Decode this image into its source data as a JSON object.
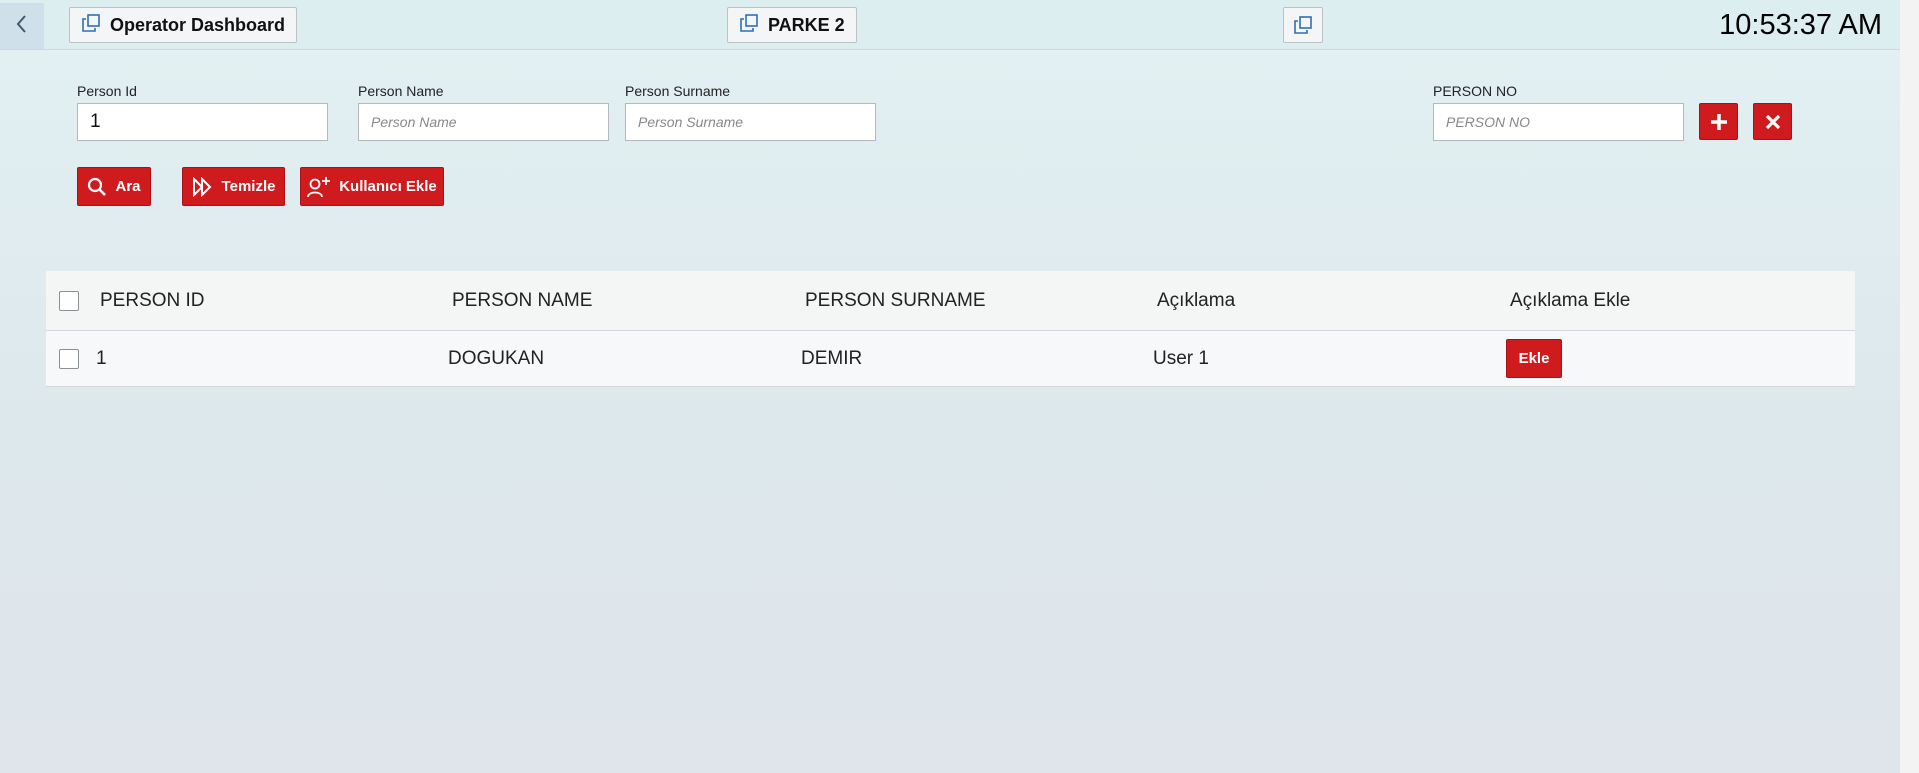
{
  "header": {
    "tab1_label": "Operator Dashboard",
    "tab2_label": "PARKE 2",
    "clock": "10:53:37 AM"
  },
  "form": {
    "person_id": {
      "label": "Person Id",
      "value": "1",
      "placeholder": ""
    },
    "person_name": {
      "label": "Person Name",
      "value": "",
      "placeholder": "Person Name"
    },
    "person_surname": {
      "label": "Person Surname",
      "value": "",
      "placeholder": "Person Surname"
    },
    "person_no": {
      "label": "PERSON NO",
      "value": "",
      "placeholder": "PERSON NO"
    },
    "search_label": "Ara",
    "clear_label": "Temizle",
    "add_user_label": "Kullanıcı Ekle"
  },
  "table": {
    "columns": [
      "PERSON ID",
      "PERSON NAME",
      "PERSON SURNAME",
      "Açıklama",
      "Açıklama Ekle"
    ],
    "rows": [
      {
        "id": "1",
        "name": "DOGUKAN",
        "surname": "DEMIR",
        "description": "User 1",
        "action_label": "Ekle"
      }
    ]
  },
  "colors": {
    "accent": "#cf1a1e",
    "background": "#e3f1f3"
  }
}
